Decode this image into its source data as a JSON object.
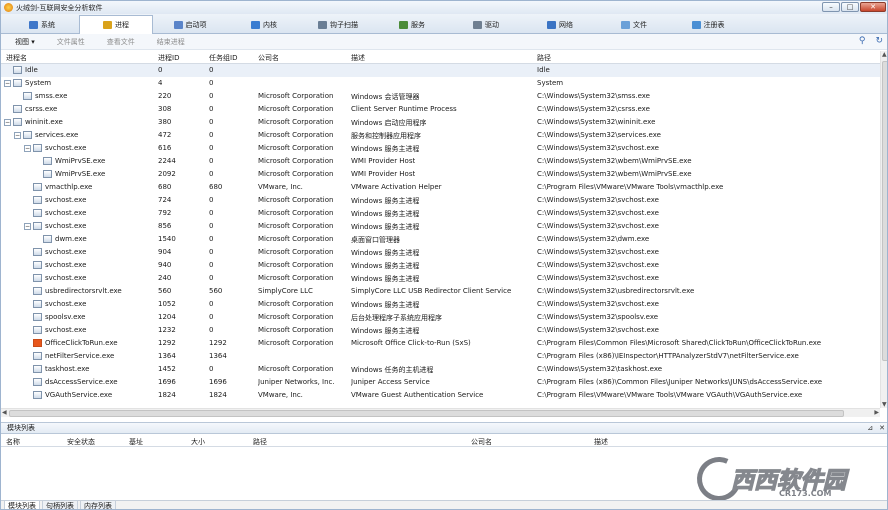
{
  "window": {
    "title": "火绒剑-互联网安全分析软件",
    "buttons": [
      "–",
      "□",
      "✕"
    ]
  },
  "tabs": [
    {
      "label": "系统",
      "icon": "monitor-icon",
      "color": "#3f77c9"
    },
    {
      "label": "进程",
      "icon": "process-icon",
      "color": "#d9a21b",
      "active": true
    },
    {
      "label": "启动项",
      "icon": "startup-icon",
      "color": "#5a84c9"
    },
    {
      "label": "内核",
      "icon": "kernel-icon",
      "color": "#3a7dd1"
    },
    {
      "label": "钩子扫描",
      "icon": "hook-icon",
      "color": "#6a7e95"
    },
    {
      "label": "服务",
      "icon": "service-icon",
      "color": "#4b8c3a"
    },
    {
      "label": "驱动",
      "icon": "driver-icon",
      "color": "#6f7f91"
    },
    {
      "label": "网络",
      "icon": "network-icon",
      "color": "#3b74c4"
    },
    {
      "label": "文件",
      "icon": "file-icon",
      "color": "#6aa0d8"
    },
    {
      "label": "注册表",
      "icon": "registry-icon",
      "color": "#4a8fd4"
    }
  ],
  "toolbar": {
    "view": "视图 ▾",
    "file_props": "文件属性",
    "view_file": "查看文件",
    "end_process": "结束进程"
  },
  "columns": [
    "进程名",
    "进程ID",
    "任务组ID",
    "公司名",
    "描述",
    "路径"
  ],
  "processes": [
    {
      "indent": 0,
      "exp": "",
      "name": "Idle",
      "pid": "0",
      "tgid": "0",
      "company": "",
      "desc": "",
      "path": "Idle",
      "sel": true
    },
    {
      "indent": 0,
      "exp": "−",
      "name": "System",
      "pid": "4",
      "tgid": "0",
      "company": "",
      "desc": "",
      "path": "System"
    },
    {
      "indent": 1,
      "exp": "",
      "name": "smss.exe",
      "pid": "220",
      "tgid": "0",
      "company": "Microsoft Corporation",
      "desc": "Windows 会话管理器",
      "path": "C:\\Windows\\System32\\smss.exe"
    },
    {
      "indent": 0,
      "exp": "",
      "name": "csrss.exe",
      "pid": "308",
      "tgid": "0",
      "company": "Microsoft Corporation",
      "desc": "Client Server Runtime Process",
      "path": "C:\\Windows\\System32\\csrss.exe"
    },
    {
      "indent": 0,
      "exp": "−",
      "name": "wininit.exe",
      "pid": "380",
      "tgid": "0",
      "company": "Microsoft Corporation",
      "desc": "Windows 启动应用程序",
      "path": "C:\\Windows\\System32\\wininit.exe"
    },
    {
      "indent": 1,
      "exp": "−",
      "name": "services.exe",
      "pid": "472",
      "tgid": "0",
      "company": "Microsoft Corporation",
      "desc": "服务和控制器应用程序",
      "path": "C:\\Windows\\System32\\services.exe"
    },
    {
      "indent": 2,
      "exp": "−",
      "name": "svchost.exe",
      "pid": "616",
      "tgid": "0",
      "company": "Microsoft Corporation",
      "desc": "Windows 服务主进程",
      "path": "C:\\Windows\\System32\\svchost.exe"
    },
    {
      "indent": 3,
      "exp": "",
      "name": "WmiPrvSE.exe",
      "pid": "2244",
      "tgid": "0",
      "company": "Microsoft Corporation",
      "desc": "WMI Provider Host",
      "path": "C:\\Windows\\System32\\wbem\\WmiPrvSE.exe"
    },
    {
      "indent": 3,
      "exp": "",
      "name": "WmiPrvSE.exe",
      "pid": "2092",
      "tgid": "0",
      "company": "Microsoft Corporation",
      "desc": "WMI Provider Host",
      "path": "C:\\Windows\\System32\\wbem\\WmiPrvSE.exe"
    },
    {
      "indent": 2,
      "exp": "",
      "name": "vmacthlp.exe",
      "pid": "680",
      "tgid": "680",
      "company": "VMware, Inc.",
      "desc": "VMware Activation Helper",
      "path": "C:\\Program Files\\VMware\\VMware Tools\\vmacthlp.exe"
    },
    {
      "indent": 2,
      "exp": "",
      "name": "svchost.exe",
      "pid": "724",
      "tgid": "0",
      "company": "Microsoft Corporation",
      "desc": "Windows 服务主进程",
      "path": "C:\\Windows\\System32\\svchost.exe"
    },
    {
      "indent": 2,
      "exp": "",
      "name": "svchost.exe",
      "pid": "792",
      "tgid": "0",
      "company": "Microsoft Corporation",
      "desc": "Windows 服务主进程",
      "path": "C:\\Windows\\System32\\svchost.exe"
    },
    {
      "indent": 2,
      "exp": "−",
      "name": "svchost.exe",
      "pid": "856",
      "tgid": "0",
      "company": "Microsoft Corporation",
      "desc": "Windows 服务主进程",
      "path": "C:\\Windows\\System32\\svchost.exe"
    },
    {
      "indent": 3,
      "exp": "",
      "name": "dwm.exe",
      "pid": "1540",
      "tgid": "0",
      "company": "Microsoft Corporation",
      "desc": "桌面窗口管理器",
      "path": "C:\\Windows\\System32\\dwm.exe"
    },
    {
      "indent": 2,
      "exp": "",
      "name": "svchost.exe",
      "pid": "904",
      "tgid": "0",
      "company": "Microsoft Corporation",
      "desc": "Windows 服务主进程",
      "path": "C:\\Windows\\System32\\svchost.exe"
    },
    {
      "indent": 2,
      "exp": "",
      "name": "svchost.exe",
      "pid": "940",
      "tgid": "0",
      "company": "Microsoft Corporation",
      "desc": "Windows 服务主进程",
      "path": "C:\\Windows\\System32\\svchost.exe"
    },
    {
      "indent": 2,
      "exp": "",
      "name": "svchost.exe",
      "pid": "240",
      "tgid": "0",
      "company": "Microsoft Corporation",
      "desc": "Windows 服务主进程",
      "path": "C:\\Windows\\System32\\svchost.exe"
    },
    {
      "indent": 2,
      "exp": "",
      "name": "usbredirectorsrvlt.exe",
      "pid": "560",
      "tgid": "560",
      "company": "SimplyCore LLC",
      "desc": "SimplyCore LLC USB Redirector Client Service",
      "path": "C:\\Windows\\System32\\usbredirectorsrvlt.exe"
    },
    {
      "indent": 2,
      "exp": "",
      "name": "svchost.exe",
      "pid": "1052",
      "tgid": "0",
      "company": "Microsoft Corporation",
      "desc": "Windows 服务主进程",
      "path": "C:\\Windows\\System32\\svchost.exe"
    },
    {
      "indent": 2,
      "exp": "",
      "name": "spoolsv.exe",
      "pid": "1204",
      "tgid": "0",
      "company": "Microsoft Corporation",
      "desc": "后台处理程序子系统应用程序",
      "path": "C:\\Windows\\System32\\spoolsv.exe"
    },
    {
      "indent": 2,
      "exp": "",
      "name": "svchost.exe",
      "pid": "1232",
      "tgid": "0",
      "company": "Microsoft Corporation",
      "desc": "Windows 服务主进程",
      "path": "C:\\Windows\\System32\\svchost.exe"
    },
    {
      "indent": 2,
      "exp": "",
      "name": "OfficeClickToRun.exe",
      "pid": "1292",
      "tgid": "1292",
      "company": "Microsoft Corporation",
      "desc": "Microsoft Office Click-to-Run (SxS)",
      "path": "C:\\Program Files\\Common Files\\Microsoft Shared\\ClickToRun\\OfficeClickToRun.exe",
      "office": true
    },
    {
      "indent": 2,
      "exp": "",
      "name": "netFilterService.exe",
      "pid": "1364",
      "tgid": "1364",
      "company": "",
      "desc": "",
      "path": "C:\\Program Files (x86)\\IEInspector\\HTTPAnalyzerStdV7\\netFilterService.exe"
    },
    {
      "indent": 2,
      "exp": "",
      "name": "taskhost.exe",
      "pid": "1452",
      "tgid": "0",
      "company": "Microsoft Corporation",
      "desc": "Windows 任务的主机进程",
      "path": "C:\\Windows\\System32\\taskhost.exe"
    },
    {
      "indent": 2,
      "exp": "",
      "name": "dsAccessService.exe",
      "pid": "1696",
      "tgid": "1696",
      "company": "Juniper Networks, Inc.",
      "desc": "Juniper Access Service",
      "path": "C:\\Program Files (x86)\\Common Files\\Juniper Networks\\JUNS\\dsAccessService.exe"
    },
    {
      "indent": 2,
      "exp": "",
      "name": "VGAuthService.exe",
      "pid": "1824",
      "tgid": "1824",
      "company": "VMware, Inc.",
      "desc": "VMware Guest Authentication Service",
      "path": "C:\\Program Files\\VMware\\VMware Tools\\VMware VGAuth\\VGAuthService.exe"
    }
  ],
  "module_panel": {
    "title": "模块列表",
    "columns": [
      "名称",
      "安全状态",
      "基址",
      "大小",
      "路径",
      "公司名",
      "描述"
    ]
  },
  "watermark": {
    "brand": "西西软件园",
    "url": "CR173.COM"
  },
  "bottom_tabs": [
    "模块列表",
    "句柄列表",
    "内存列表"
  ]
}
